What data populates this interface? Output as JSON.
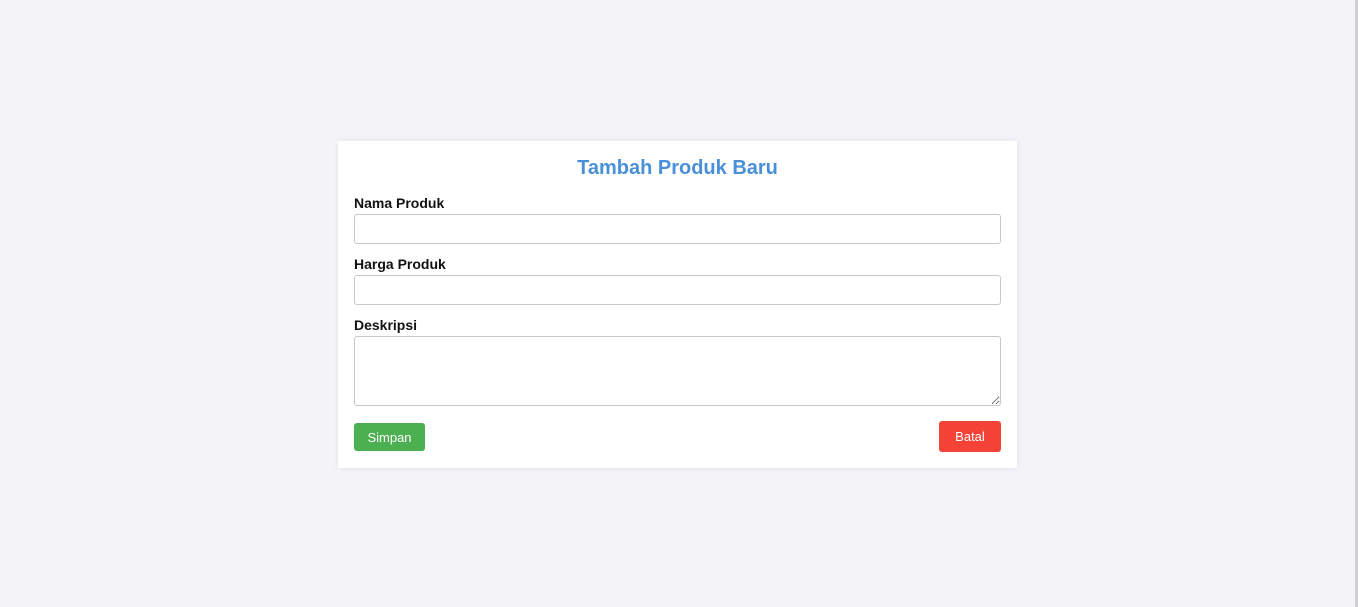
{
  "form": {
    "title": "Tambah Produk Baru",
    "fields": {
      "name": {
        "label": "Nama Produk",
        "value": "",
        "placeholder": ""
      },
      "price": {
        "label": "Harga Produk",
        "value": "",
        "placeholder": ""
      },
      "description": {
        "label": "Deskripsi",
        "value": "",
        "placeholder": ""
      }
    },
    "actions": {
      "save_label": "Simpan",
      "cancel_label": "Batal"
    }
  },
  "colors": {
    "background": "#f4f4f8",
    "title": "#4a90d9",
    "save_button": "#4caf50",
    "cancel_button": "#f44336"
  }
}
